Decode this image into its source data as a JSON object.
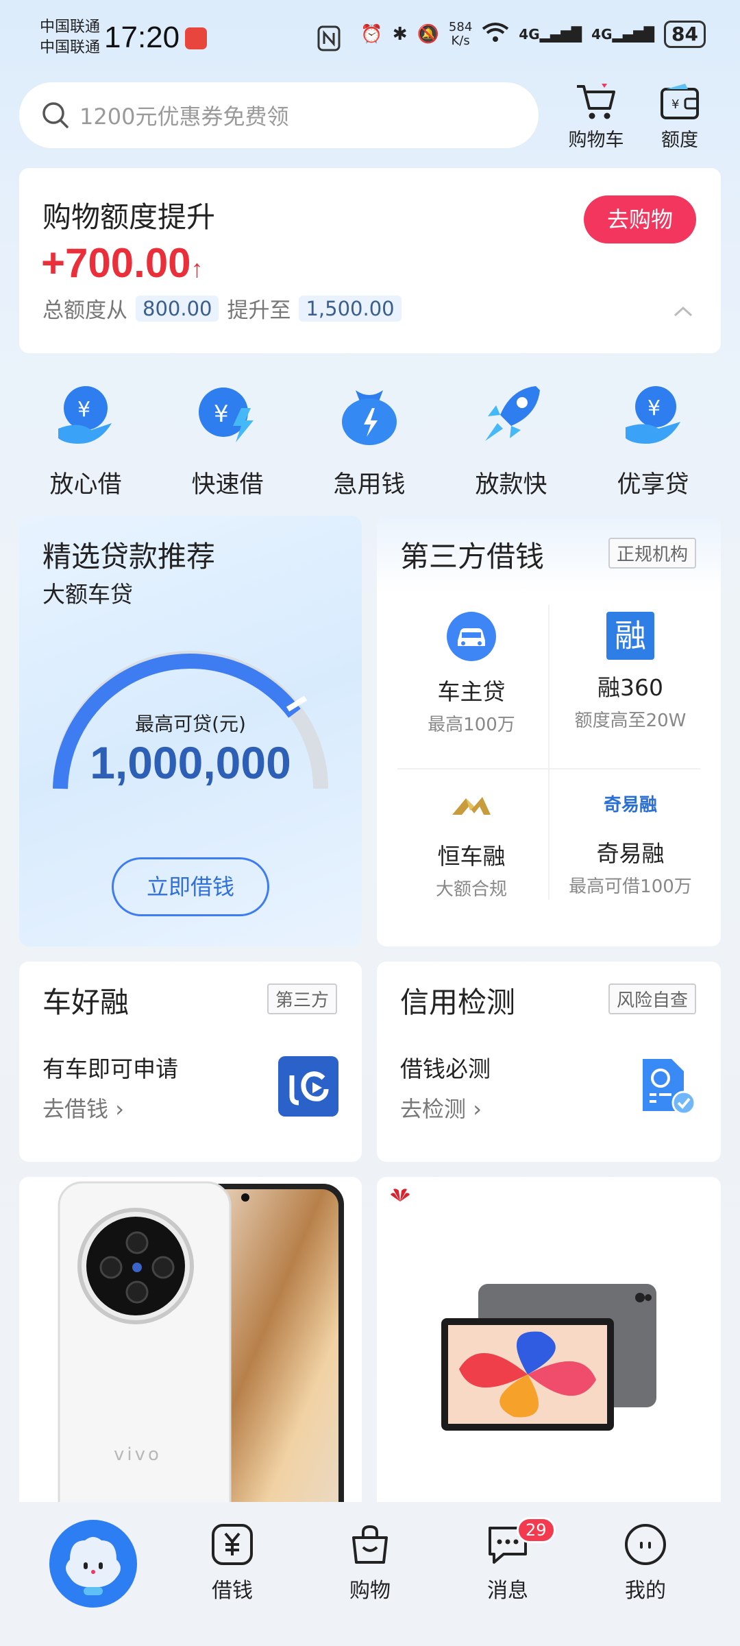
{
  "status_bar": {
    "carrier1": "中国联通",
    "carrier2": "中国联通",
    "time": "17:20",
    "speed_value": "584",
    "speed_unit": "K/s",
    "net1": "4G",
    "net2": "4G",
    "battery": "84"
  },
  "search": {
    "placeholder": "1200元优惠券免费领"
  },
  "top_actions": {
    "cart_label": "购物车",
    "quota_label": "额度"
  },
  "quota_card": {
    "title": "购物额度提升",
    "amount": "+700.00",
    "from_label": "总额度从",
    "from_value": "800.00",
    "to_label": "提升至",
    "to_value": "1,500.00",
    "shop_button": "去购物"
  },
  "quick_entries": [
    {
      "label": "放心借",
      "icon": "hand-yuan-icon"
    },
    {
      "label": "快速借",
      "icon": "fast-yuan-icon"
    },
    {
      "label": "急用钱",
      "icon": "money-bag-icon"
    },
    {
      "label": "放款快",
      "icon": "rocket-icon"
    },
    {
      "label": "优享贷",
      "icon": "hand-yuan-icon"
    }
  ],
  "recommend": {
    "title": "精选贷款推荐",
    "subtitle": "大额车贷",
    "max_label": "最高可贷(元)",
    "max_value": "1,000,000",
    "button": "立即借钱"
  },
  "third_party": {
    "title": "第三方借钱",
    "tag": "正规机构",
    "items": [
      {
        "name": "车主贷",
        "sub": "最高100万"
      },
      {
        "name": "融360",
        "sub": "额度高至20W"
      },
      {
        "name": "恒车融",
        "sub": "大额合规"
      },
      {
        "name": "奇易融",
        "sub": "最高可借100万"
      }
    ],
    "logo_text_rong": "融",
    "logo_text_qiyirong": "奇易融"
  },
  "car_loan": {
    "title": "车好融",
    "tag": "第三方",
    "desc": "有车即可申请",
    "link": "去借钱"
  },
  "credit_check": {
    "title": "信用检测",
    "tag": "风险自查",
    "desc": "借钱必测",
    "link": "去检测"
  },
  "products": {
    "phone_brand": "vivo"
  },
  "bottom_nav": {
    "borrow": "借钱",
    "shop": "购物",
    "messages": "消息",
    "messages_badge": "29",
    "mine": "我的"
  },
  "colors": {
    "accent_red": "#ea2f3a",
    "button_pink": "#f2365d",
    "blue": "#3e86f5"
  }
}
